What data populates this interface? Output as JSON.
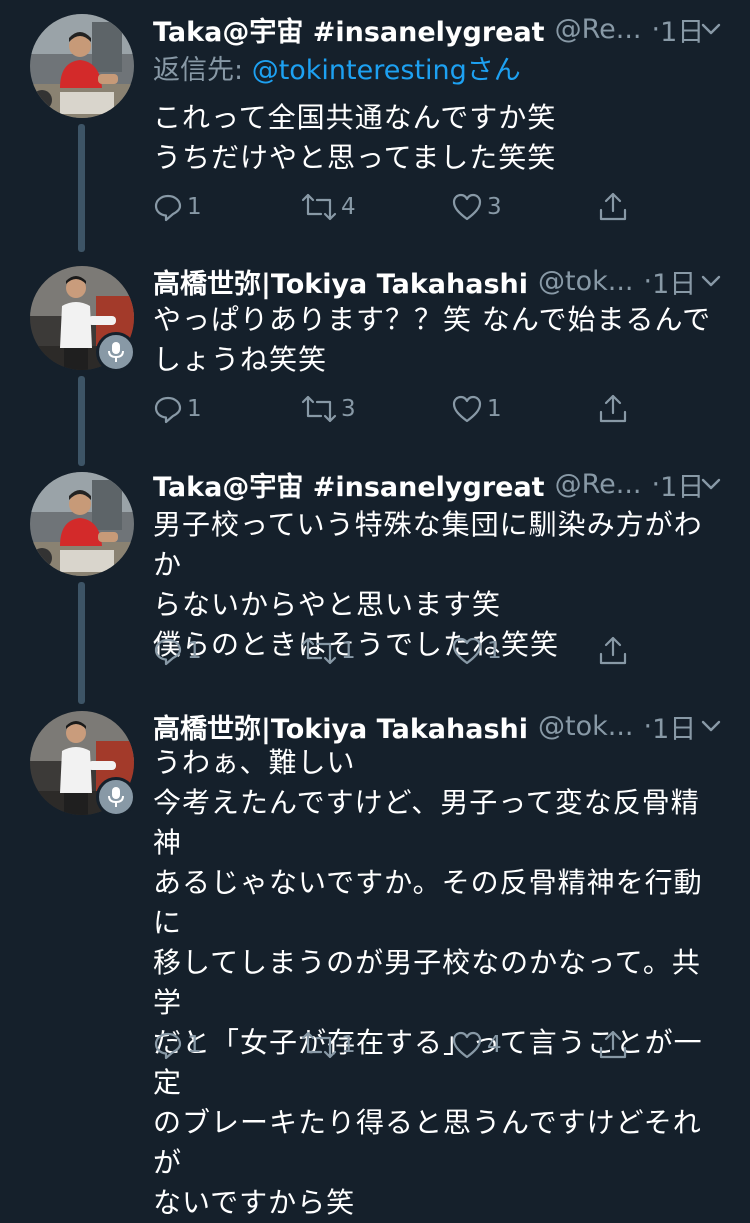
{
  "tweets": [
    {
      "name": "Taka@宇宙 #insanelygreat",
      "handle": "@Re...",
      "dot": "·",
      "time": "1日",
      "reply_label": "返信先: ",
      "reply_mention": "@tokinteresting",
      "reply_suffix": "さん",
      "text": "これって全国共通なんですか笑\nうちだけやと思ってました笑笑",
      "replies": "1",
      "retweets": "4",
      "likes": "3",
      "avatar": "person-red-shirt",
      "badge": null
    },
    {
      "name": "高橋世弥|Tokiya Takahashi",
      "handle": "@tok...",
      "dot": "·",
      "time": "1日",
      "text": "やっぱりあります？？笑 なんで始まるんで\nしょうね笑笑",
      "replies": "1",
      "retweets": "3",
      "likes": "1",
      "avatar": "person-white-shirt",
      "badge": "microphone-icon"
    },
    {
      "name": "Taka@宇宙 #insanelygreat",
      "handle": "@Re...",
      "dot": "·",
      "time": "1日",
      "text": "男子校っていう特殊な集団に馴染み方がわか\nらないからやと思います笑\n僕らのときはそうでしたね笑笑",
      "replies": "1",
      "retweets": "1",
      "likes": "1",
      "avatar": "person-red-shirt",
      "badge": null
    },
    {
      "name": "高橋世弥|Tokiya Takahashi",
      "handle": "@tok...",
      "dot": "·",
      "time": "1日",
      "text": "うわぁ、難しい\n今考えたんですけど、男子って変な反骨精神\nあるじゃないですか。その反骨精神を行動に\n移してしまうのが男子校なのかなって。共学\nだと「女子が存在する」って言うことが一定\nのブレーキたり得ると思うんですけどそれが\nないですから笑",
      "replies": "1",
      "retweets": "1",
      "likes": "4",
      "avatar": "person-white-shirt",
      "badge": "microphone-icon"
    }
  ],
  "colors": {
    "background": "#15202b",
    "text": "#ffffff",
    "secondary": "#8899a6",
    "link": "#1da1f2",
    "thread_line": "#3d5466"
  }
}
